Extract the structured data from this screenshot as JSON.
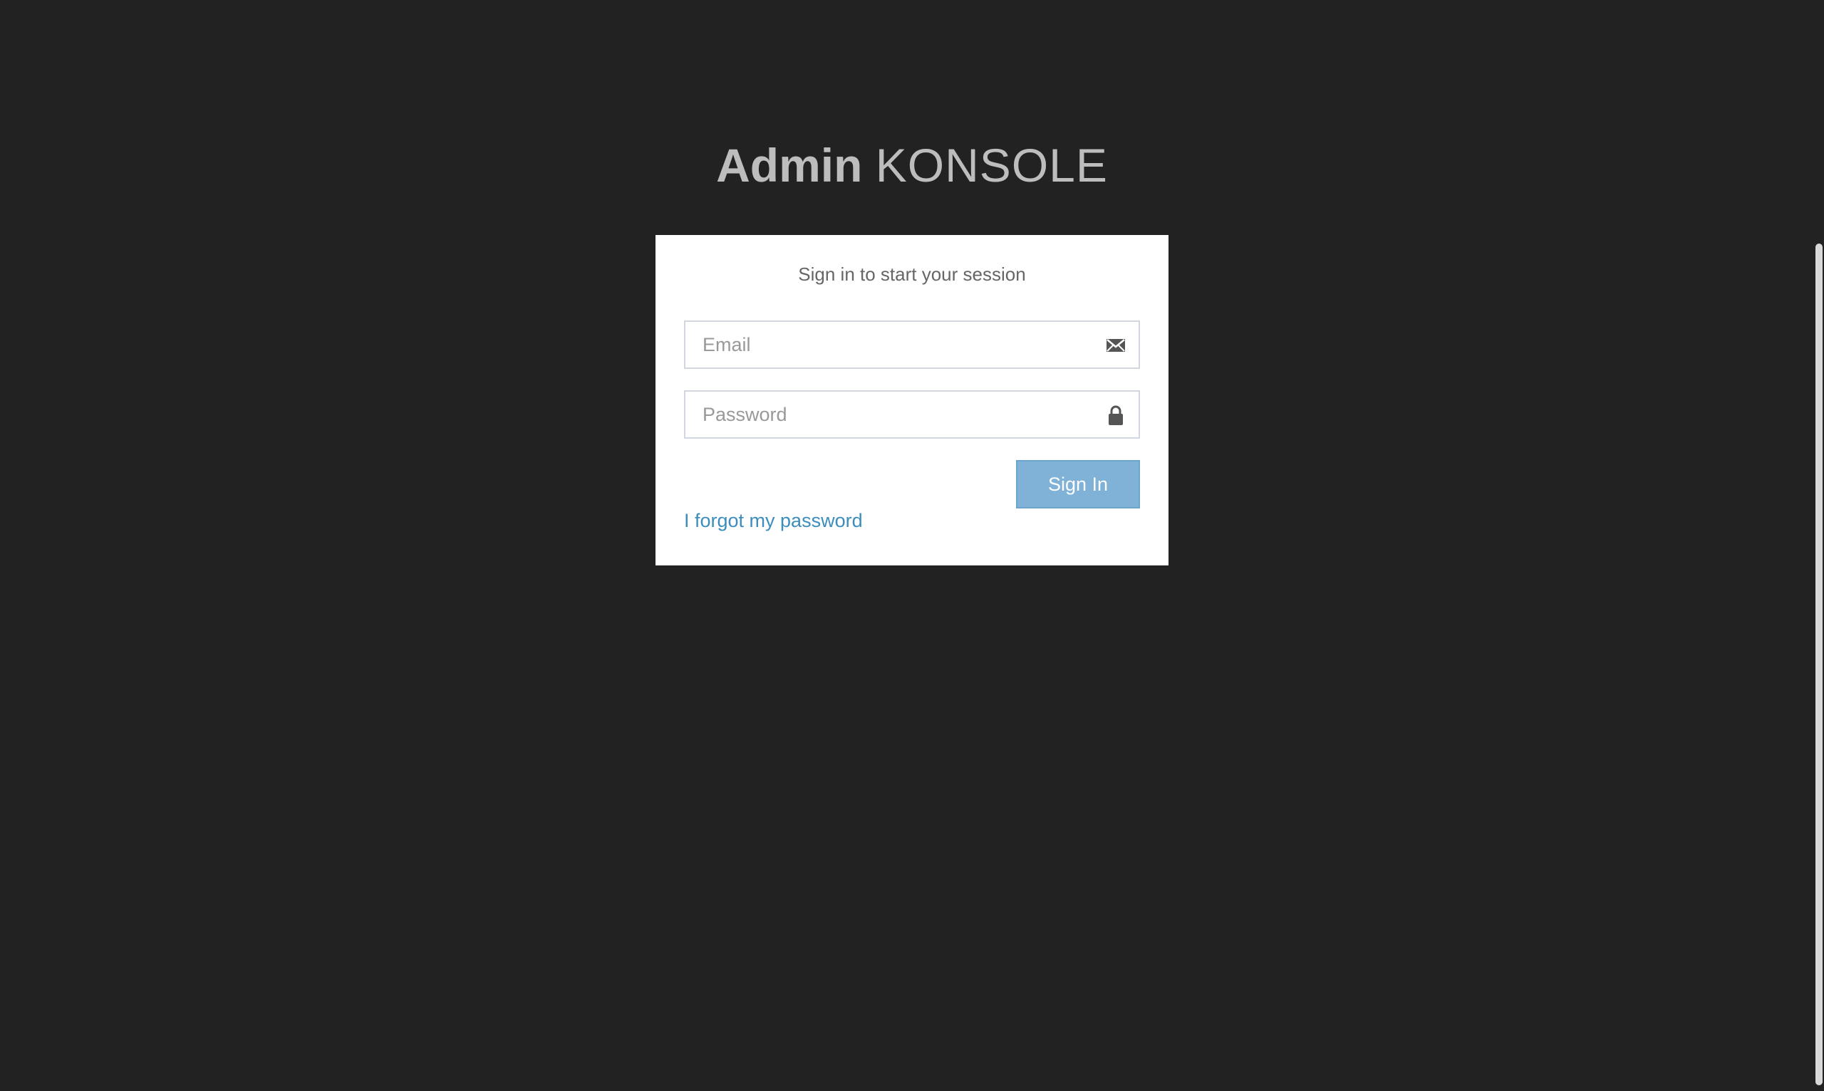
{
  "logo": {
    "bold_text": "Admin",
    "light_text": "KONSOLE"
  },
  "login": {
    "message": "Sign in to start your session",
    "email": {
      "placeholder": "Email",
      "value": "",
      "icon": "envelope-icon"
    },
    "password": {
      "placeholder": "Password",
      "value": "",
      "icon": "lock-icon"
    },
    "submit_label": "Sign In",
    "forgot_label": "I forgot my password"
  },
  "colors": {
    "background": "#222222",
    "box_background": "#ffffff",
    "button": "#7fb2d6",
    "link": "#3c8dbc",
    "logo_text": "#bdbdbd"
  }
}
